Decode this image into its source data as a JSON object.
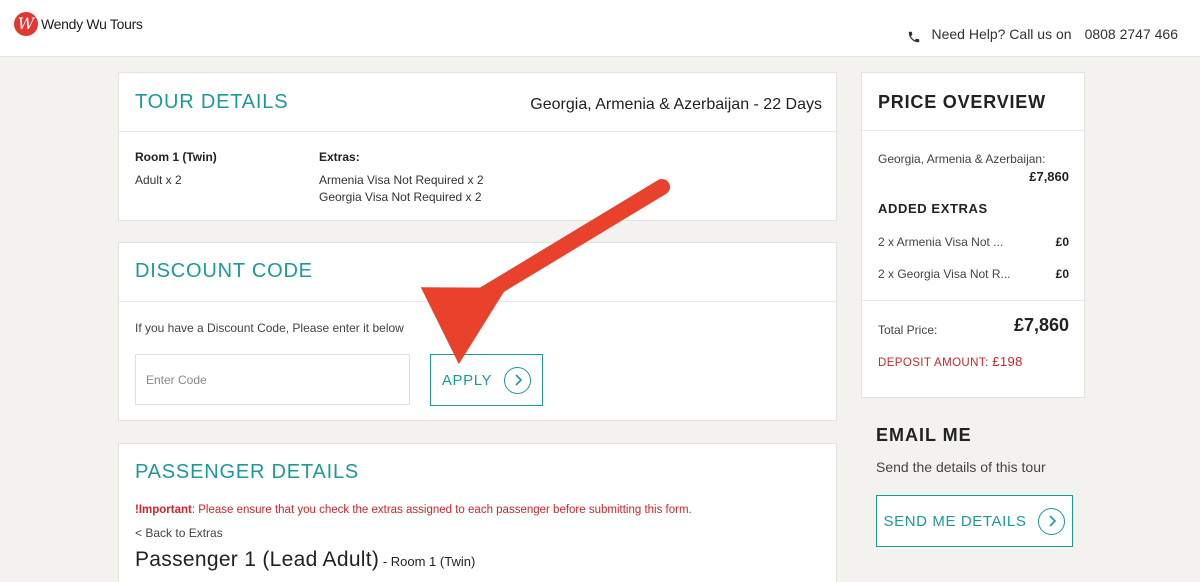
{
  "header": {
    "brand": "Wendy Wu Tours",
    "logo_letter": "W",
    "help_text": "Need Help? Call us on",
    "phone": "0808 2747 466"
  },
  "tour_details": {
    "title": "TOUR DETAILS",
    "tour_name": "Georgia, Armenia & Azerbaijan - 22 Days",
    "room_label": "Room 1 (Twin)",
    "room_value": "Adult x 2",
    "extras_label": "Extras:",
    "extras": [
      "Armenia Visa Not Required x 2",
      "Georgia Visa Not Required x 2"
    ]
  },
  "discount": {
    "title": "DISCOUNT CODE",
    "help_text": "If you have a Discount Code, Please enter it below",
    "placeholder": "Enter Code",
    "apply_label": "APPLY"
  },
  "passenger": {
    "title": "PASSENGER DETAILS",
    "important_label": "!Important",
    "important_text": ": Please ensure that you check the extras assigned to each passenger before submitting this form.",
    "back_link": "< Back to Extras",
    "passenger_title": "Passenger 1 (Lead Adult)",
    "passenger_sub": " - Room 1 (Twin)"
  },
  "price_overview": {
    "title": "PRICE OVERVIEW",
    "tour_label": "Georgia, Armenia & Azerbaijan:",
    "tour_price": "£7,860",
    "added_extras_title": "ADDED EXTRAS",
    "extras": [
      {
        "label": "2 x Armenia Visa Not ...",
        "amount": "£0"
      },
      {
        "label": "2 x Georgia Visa Not R...",
        "amount": "£0"
      }
    ],
    "total_label": "Total Price:",
    "total_amount": "£7,860",
    "deposit_label": "DEPOSIT AMOUNT:",
    "deposit_amount": "£198"
  },
  "email_me": {
    "title": "EMAIL ME",
    "subtitle": "Send the details of this tour",
    "button_label": "SEND ME DETAILS"
  },
  "colors": {
    "accent": "#1b9a96",
    "alert": "#d2232a",
    "annotation_arrow": "#e8412c",
    "page_bg": "#f3f2ee"
  }
}
